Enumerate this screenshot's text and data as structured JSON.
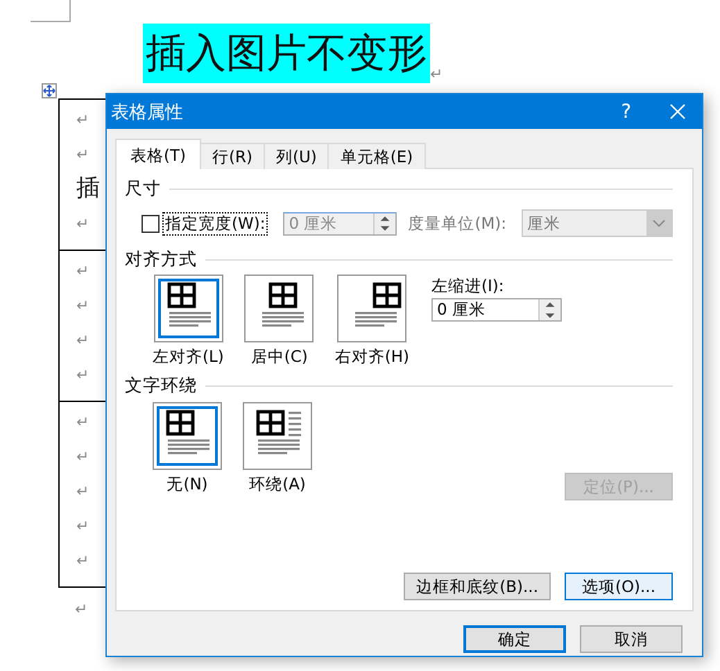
{
  "document": {
    "heading": "插入图片不变形",
    "heading_mark": "↵",
    "table_rows": [
      {
        "lines": [
          "↵",
          "↵",
          "插",
          "↵"
        ]
      },
      {
        "lines": [
          "↵",
          "↵",
          "↵",
          "↵"
        ]
      },
      {
        "lines": [
          "↵",
          "↵",
          "↵",
          "↵",
          "↵"
        ]
      }
    ],
    "after_mark": "↵"
  },
  "dialog": {
    "title": "表格属性",
    "help": "?",
    "tabs": [
      {
        "label": "表格(T)",
        "selected": true
      },
      {
        "label": "行(R)",
        "selected": false
      },
      {
        "label": "列(U)",
        "selected": false
      },
      {
        "label": "单元格(E)",
        "selected": false
      }
    ],
    "size": {
      "heading": "尺寸",
      "width_checkbox": {
        "label": "指定宽度(W):",
        "checked": false
      },
      "width_field": {
        "value": "0 厘米",
        "disabled": true
      },
      "unit_label": "度量单位(M):",
      "unit_select": {
        "value": "厘米",
        "disabled": true
      }
    },
    "alignment": {
      "heading": "对齐方式",
      "options": [
        {
          "label": "左对齐(L)",
          "kind": "left",
          "selected": true
        },
        {
          "label": "居中(C)",
          "kind": "center",
          "selected": false
        },
        {
          "label": "右对齐(H)",
          "kind": "right",
          "selected": false
        }
      ],
      "indent_label": "左缩进(I):",
      "indent_field": {
        "value": "0 厘米"
      }
    },
    "wrapping": {
      "heading": "文字环绕",
      "options": [
        {
          "label": "无(N)",
          "kind": "none",
          "selected": true
        },
        {
          "label": "环绕(A)",
          "kind": "around",
          "selected": false
        }
      ],
      "position_button": {
        "label": "定位(P)...",
        "disabled": true
      }
    },
    "buttons": [
      {
        "label": "边框和底纹(B)...",
        "focused": false
      },
      {
        "label": "选项(O)...",
        "focused": true
      }
    ],
    "footer_buttons": [
      {
        "label": "确定",
        "default": true
      },
      {
        "label": "取消",
        "default": false
      }
    ]
  }
}
